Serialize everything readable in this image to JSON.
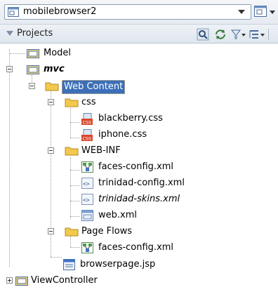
{
  "header": {
    "app_selector": {
      "value": "mobilebrowser2",
      "icon": "application-icon"
    }
  },
  "panel": {
    "title": "Projects",
    "toolbar": [
      "search-icon",
      "sync-icon",
      "filter-icon",
      "tree-options-icon"
    ]
  },
  "tree": {
    "model": "Model",
    "mvc": "mvc",
    "web_content": "Web Content",
    "css": "css",
    "blackberry_css": "blackberry.css",
    "iphone_css": "iphone.css",
    "web_inf": "WEB-INF",
    "faces_config": "faces-config.xml",
    "trinidad_config": "trinidad-config.xml",
    "trinidad_skins": "trinidad-skins.xml",
    "web_xml": "web.xml",
    "page_flows": "Page Flows",
    "faces_config_pf": "faces-config.xml",
    "browserpage": "browserpage.jsp",
    "viewcontroller": "ViewController"
  },
  "colors": {
    "selection": "#3c6fb8",
    "folder": "#f2c94c",
    "css_badge": "#d9462b"
  }
}
